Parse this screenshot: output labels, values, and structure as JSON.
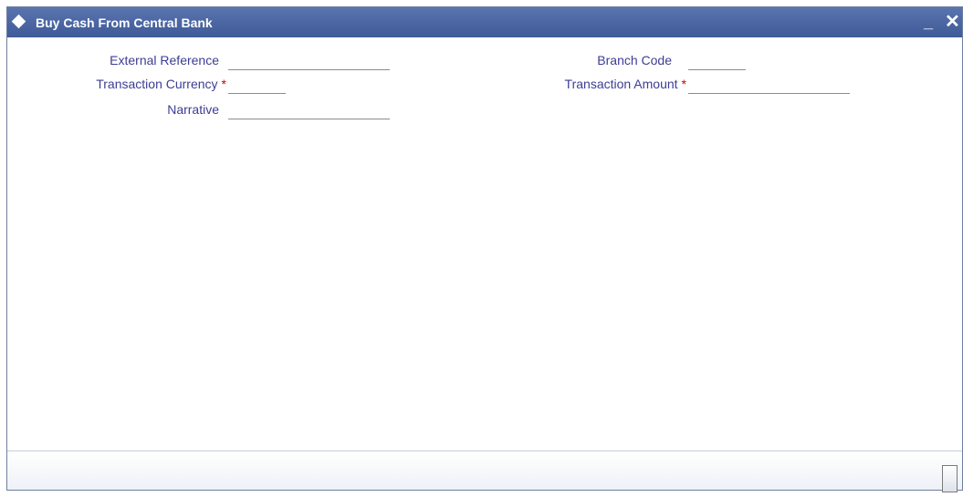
{
  "window": {
    "title": "Buy Cash From Central Bank",
    "minimize_label": "_",
    "close_label": "✕"
  },
  "form": {
    "external_reference": {
      "label": "External Reference",
      "value": ""
    },
    "branch_code": {
      "label": "Branch Code",
      "value": ""
    },
    "transaction_currency": {
      "label": "Transaction Currency",
      "required_mark": "*",
      "value": ""
    },
    "transaction_amount": {
      "label": "Transaction Amount",
      "required_mark": "*",
      "value": ""
    },
    "narrative": {
      "label": "Narrative",
      "value": ""
    }
  },
  "colors": {
    "titlebar": "#4a64a4",
    "label": "#3d3d96",
    "required": "#cc0000"
  }
}
